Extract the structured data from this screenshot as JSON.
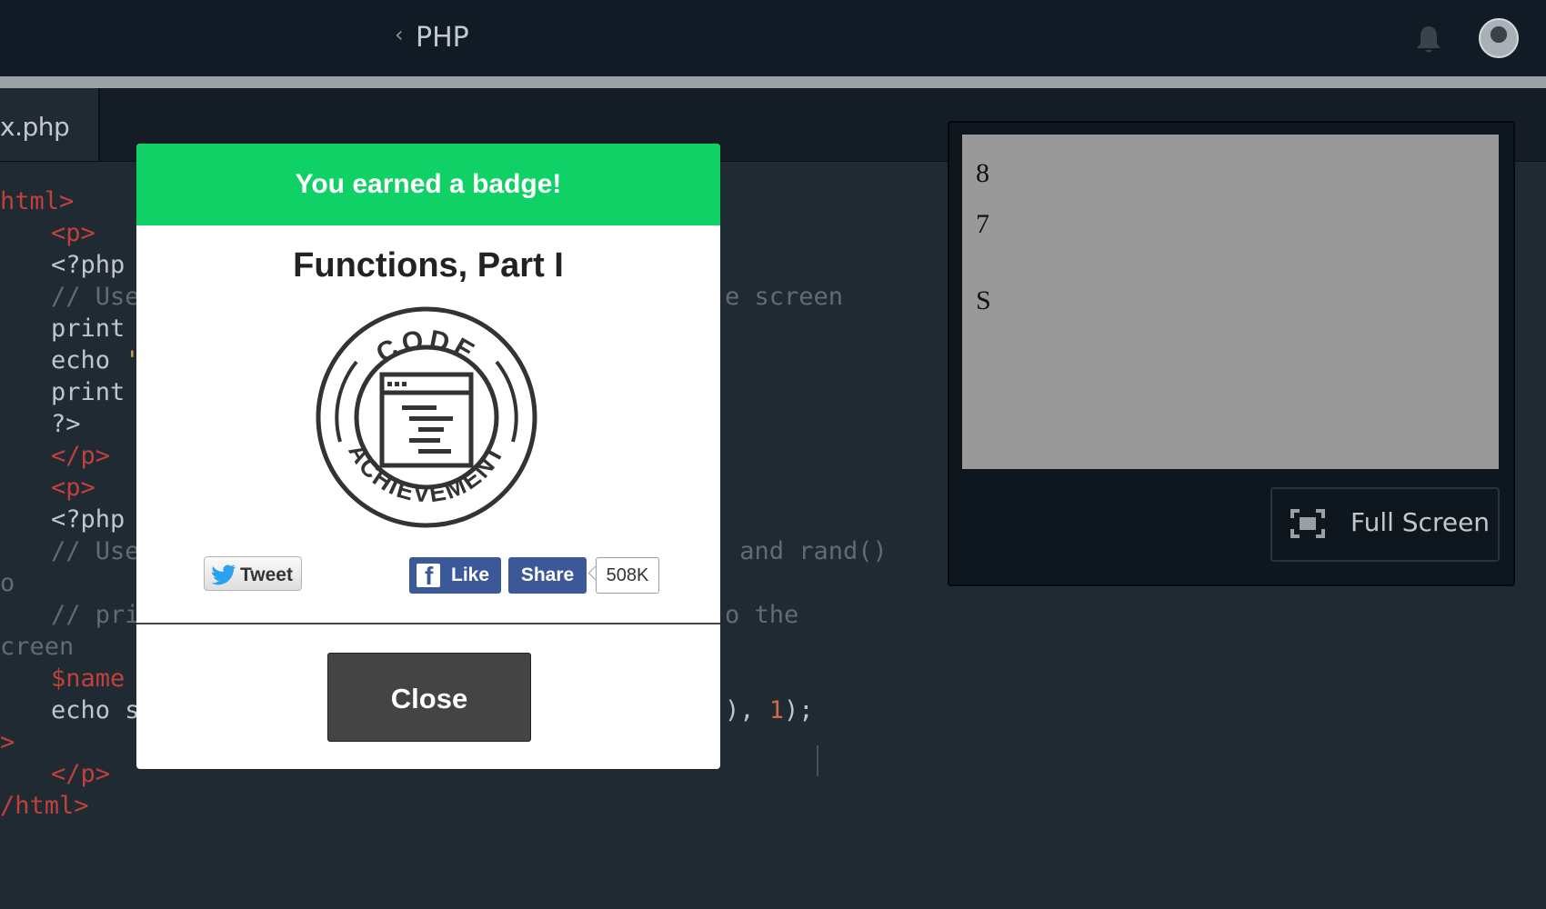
{
  "topbar": {
    "back_icon": "‹",
    "course": "PHP",
    "bell_icon": "bell-icon",
    "avatar": "user-avatar"
  },
  "editor": {
    "file_tab": "x.php",
    "lines": [
      {
        "tag": "html>"
      },
      {
        "tag": "<p>"
      },
      {
        "txt": "<?php"
      },
      {
        "cmt_a": "// Use",
        "cmt_b": "e screen"
      },
      {
        "txt": "print"
      },
      {
        "txt": "echo",
        "str": " '"
      },
      {
        "txt": "print"
      },
      {
        "txt": "?>"
      },
      {
        "tag": "</p>"
      },
      {
        "tag": "<p>"
      },
      {
        "txt": "<?php"
      },
      {
        "cmt_a": "// Use",
        "cmt_b": " and rand()"
      },
      {
        "cmt": "o"
      },
      {
        "cmt_a": "// pri",
        "cmt_b": "o the"
      },
      {
        "cmt": "creen"
      },
      {
        "var": "$name"
      },
      {
        "txt_a": "echo s",
        "txt_b": "), ",
        "num": "1",
        "txt_c": ");"
      },
      {
        "tag": ">"
      },
      {
        "tag": "</p>"
      },
      {
        "tag": "/html>"
      }
    ]
  },
  "preview": {
    "outputs": [
      "8",
      "7",
      "S"
    ],
    "fullscreen_label": "Full Screen"
  },
  "modal": {
    "header": "You earned a badge!",
    "badge_title": "Functions, Part I",
    "badge_top_text": "CODE",
    "badge_bottom_text": "ACHIEVEMENT",
    "tweet_label": "Tweet",
    "like_label": "Like",
    "share_label": "Share",
    "share_count": "508K",
    "close_label": "Close"
  },
  "colors": {
    "accent_green": "#0fd165",
    "facebook_blue": "#3b5998",
    "topbar": "#101b26",
    "editor_bg": "#202a33"
  }
}
